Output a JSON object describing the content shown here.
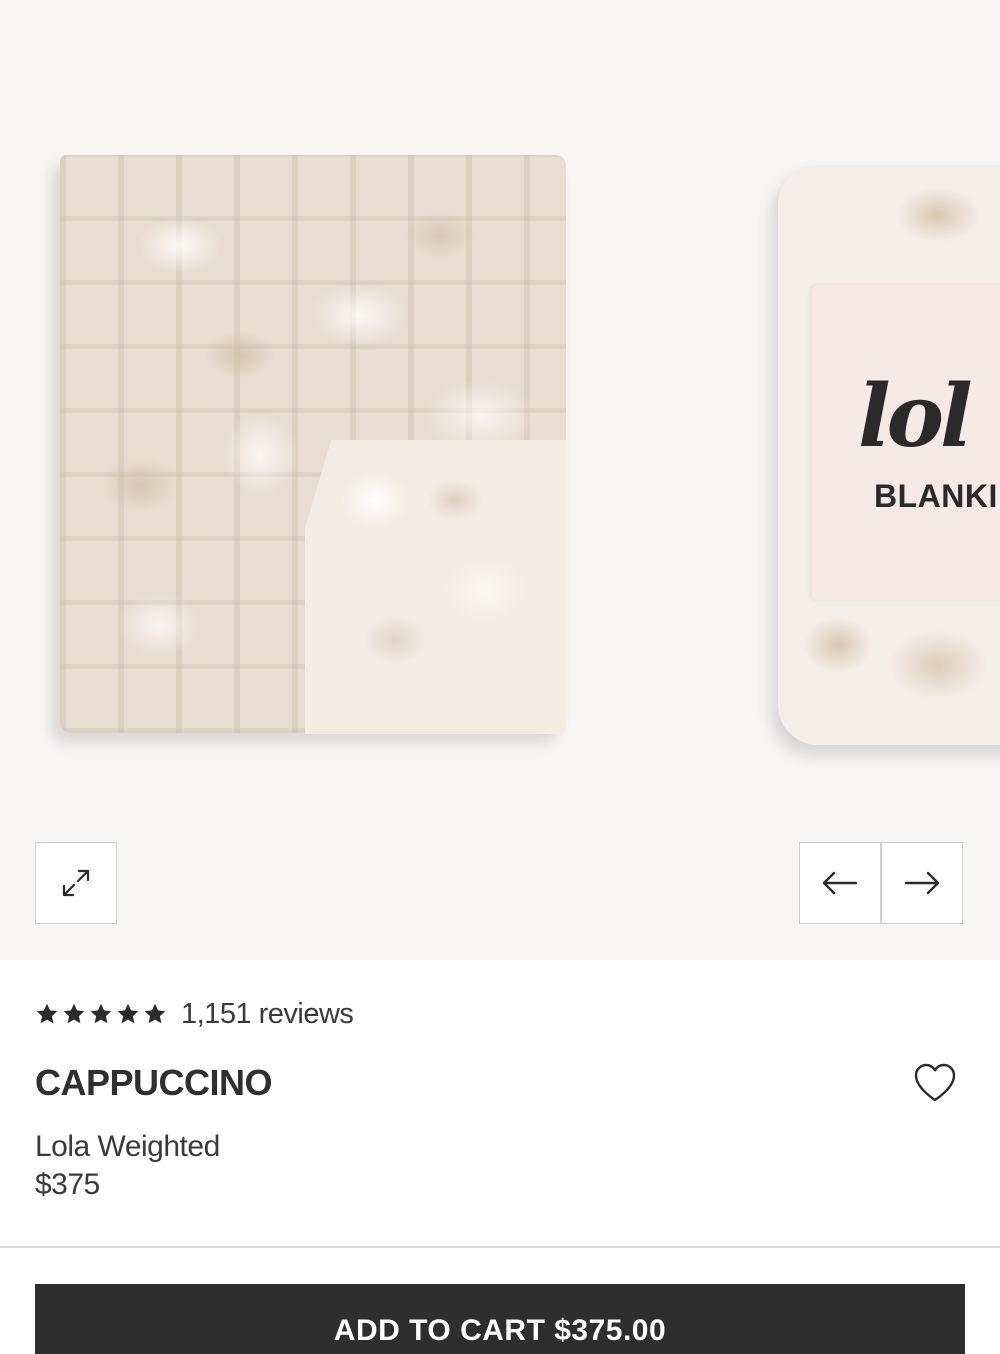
{
  "gallery": {
    "image_1_label": "blanket-flat-photo",
    "image_2_logo": "lol",
    "image_2_text": "BLANKI",
    "icons": {
      "expand": "expand-icon",
      "prev": "arrow-left-icon",
      "next": "arrow-right-icon"
    }
  },
  "product": {
    "rating_stars": 5,
    "reviews": "1,151 reviews",
    "title": "CAPPUCCINO",
    "subtitle": "Lola Weighted",
    "price": "$375",
    "wishlist_icon": "heart-icon"
  },
  "cart": {
    "label": "ADD TO CART $375.00"
  },
  "colors": {
    "background": "#f8f6f4",
    "text": "#2f2f2f",
    "button": "#2e2e2e",
    "button_text": "#ffffff"
  }
}
